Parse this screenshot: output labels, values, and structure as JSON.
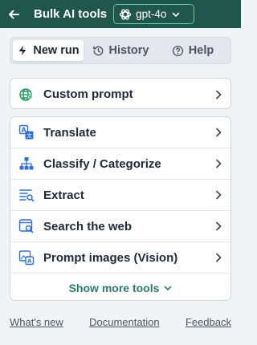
{
  "header": {
    "back_icon": "arrow-left-icon",
    "title": "Bulk AI tools",
    "model": {
      "icon": "openai-icon",
      "label": "gpt-4o",
      "chevron": "chevron-down-icon"
    }
  },
  "tabs": [
    {
      "label": "New run",
      "icon": "bolt-icon",
      "active": true
    },
    {
      "label": "History",
      "icon": "history-icon",
      "active": false
    },
    {
      "label": "Help",
      "icon": "help-circle-icon",
      "active": false
    }
  ],
  "tools_primary": [
    {
      "label": "Custom prompt",
      "icon": "globe-bolt-icon"
    }
  ],
  "tools": [
    {
      "label": "Translate",
      "icon": "translate-icon"
    },
    {
      "label": "Classify / Categorize",
      "icon": "hierarchy-icon"
    },
    {
      "label": "Extract",
      "icon": "extract-icon"
    },
    {
      "label": "Search the web",
      "icon": "web-search-icon"
    },
    {
      "label": "Prompt images (Vision)",
      "icon": "image-text-icon"
    }
  ],
  "show_more": "Show more tools",
  "footer": {
    "whats_new": "What's new",
    "documentation": "Documentation",
    "feedback": "Feedback"
  },
  "colors": {
    "header_bg": "#20564b",
    "accent": "#2f7a66",
    "pill_border": "#5fd0a0",
    "icon_blue": "#2f6fd6",
    "icon_green": "#2f9e6a"
  }
}
